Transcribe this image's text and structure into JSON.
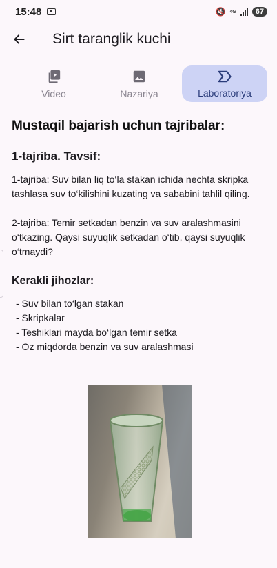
{
  "status_bar": {
    "time": "15:48",
    "network": "4G",
    "battery": "67"
  },
  "header": {
    "title": "Sirt taranglik kuchi"
  },
  "tabs": [
    {
      "label": "Video",
      "icon": "video-icon",
      "active": false
    },
    {
      "label": "Nazariya",
      "icon": "image-icon",
      "active": false
    },
    {
      "label": "Laboratoriya",
      "icon": "label-icon",
      "active": true
    }
  ],
  "main": {
    "heading": "Mustaqil bajarish uchun tajribalar:",
    "subheading": "1-tajriba. Tavsif:",
    "experiment1": "1-tajriba: Suv bilan liq to‘la stakan ichida nechta skripka tashlasa suv to‘kilishini kuzating va sababini tahlil qiling.",
    "experiment2": "2-tajriba: Temir setkadan benzin va suv aralashmasini o‘tkazing. Qaysi suyuqlik setkadan o‘tib, qaysi suyuqlik o‘tmaydi?",
    "equipment_title": "Kerakli jihozlar:",
    "equipment": [
      "- Suv bilan to‘lgan stakan",
      "- Skripkalar",
      "- Teshiklari mayda bo‘lgan temir setka",
      "- Oz miqdorda benzin va suv aralashmasi"
    ]
  },
  "colors": {
    "background": "#fcf7fb",
    "active_tab": "#cdd3f5",
    "active_tab_text": "#2a3c7a",
    "inactive_tab_text": "#8a8590"
  }
}
